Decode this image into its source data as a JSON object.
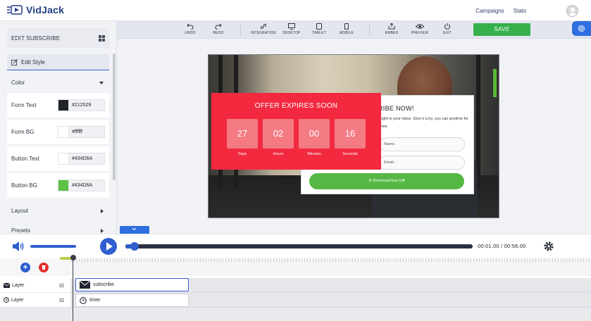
{
  "app": {
    "name": "VidJack"
  },
  "nav": {
    "campaigns": "Campaigns",
    "stats": "Stats"
  },
  "panel": {
    "title": "EDIT SUBSCRIBE",
    "edit_style": "Edit Style",
    "sections": {
      "color": "Color",
      "layout": "Layout",
      "presets": "Presets"
    },
    "color_rows": [
      {
        "label": "Form Text",
        "swatch": "#212529",
        "value": "#212529"
      },
      {
        "label": "Form BG",
        "swatch": "#ffffff",
        "value": "#ffffff"
      },
      {
        "label": "Button Text",
        "swatch": "#ffffff",
        "value": "#434D6A"
      },
      {
        "label": "Button BG",
        "swatch": "#5cc144",
        "value": "#434D6A"
      }
    ]
  },
  "toolbar": {
    "undo": "UNDO",
    "redo": "REDO",
    "integration": "INTEGRATION",
    "desktop": "DESKTOP",
    "tablet": "TABLET",
    "mobile": "MOBILE",
    "embed": "EMBED",
    "preview": "PREVIEW",
    "exit": "EXIT",
    "save": "SAVE"
  },
  "preview": {
    "subscribe_title": "RIBE NOW!",
    "subscribe_desc": "right in your inbox. Give it a try, you can anytime for free.",
    "name_placeholder": "Name..",
    "email_placeholder": "Email..",
    "download_button": "⬇ Download free Gift",
    "offer_title": "OFFER EXPIRES SOON",
    "countdown": [
      {
        "value": "27",
        "unit": "Days"
      },
      {
        "value": "02",
        "unit": "Hours"
      },
      {
        "value": "00",
        "unit": "Minutes"
      },
      {
        "value": "16",
        "unit": "Seconds"
      }
    ]
  },
  "player": {
    "current_time": "00:01.00",
    "separator": "/",
    "total_time": "00:56.00",
    "position_fraction": 0.018
  },
  "timeline": {
    "layers": [
      {
        "label": "Layer",
        "clip": "subscribe"
      },
      {
        "label": "Layer",
        "clip": "timer"
      }
    ]
  },
  "colors": {
    "accent": "#2f5fd0",
    "save": "#35b04a",
    "offer": "#f2293f",
    "download": "#55b845"
  }
}
